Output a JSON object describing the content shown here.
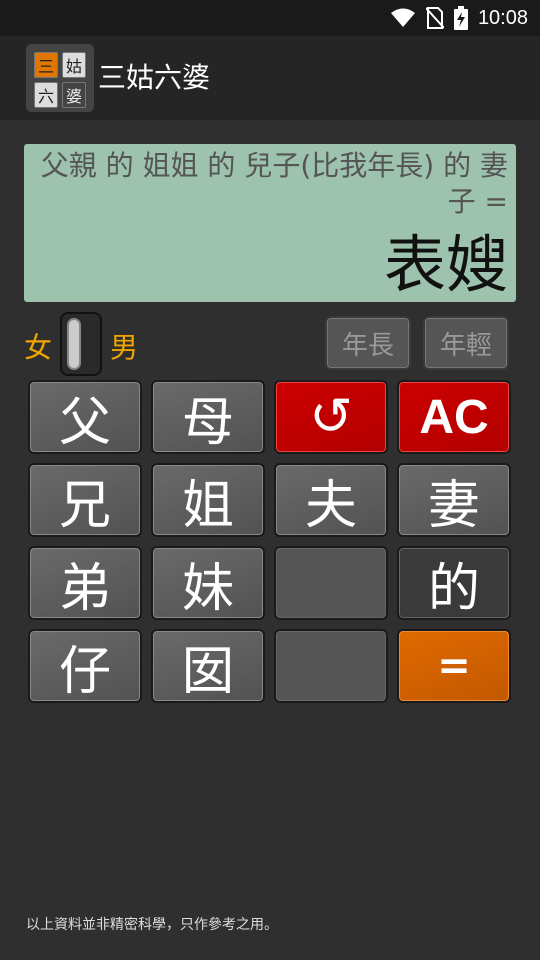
{
  "status": {
    "time": "10:08"
  },
  "app": {
    "title": "三姑六婆",
    "logo_chars": [
      "三",
      "姑",
      "六",
      "婆"
    ]
  },
  "display": {
    "expression": "父親 的 姐姐 的 兒子(比我年長) 的 妻子 =",
    "result": "表嫂"
  },
  "gender": {
    "female": "女",
    "male": "男"
  },
  "age": {
    "elder": "年長",
    "younger": "年輕"
  },
  "keys": {
    "father": "父",
    "mother": "母",
    "undo": "↺",
    "clear": "AC",
    "older_brother": "兄",
    "older_sister": "姐",
    "husband": "夫",
    "wife": "妻",
    "younger_brother": "弟",
    "younger_sister": "妹",
    "of": "的",
    "son": "仔",
    "daughter": "囡",
    "equals": "="
  },
  "footer": "以上資料並非精密科學，只作參考之用。",
  "colors": {
    "accent_orange": "#e06a00",
    "key_red": "#cc0000",
    "display_bg": "#9dc2ae",
    "gender_label": "#f0a500"
  }
}
